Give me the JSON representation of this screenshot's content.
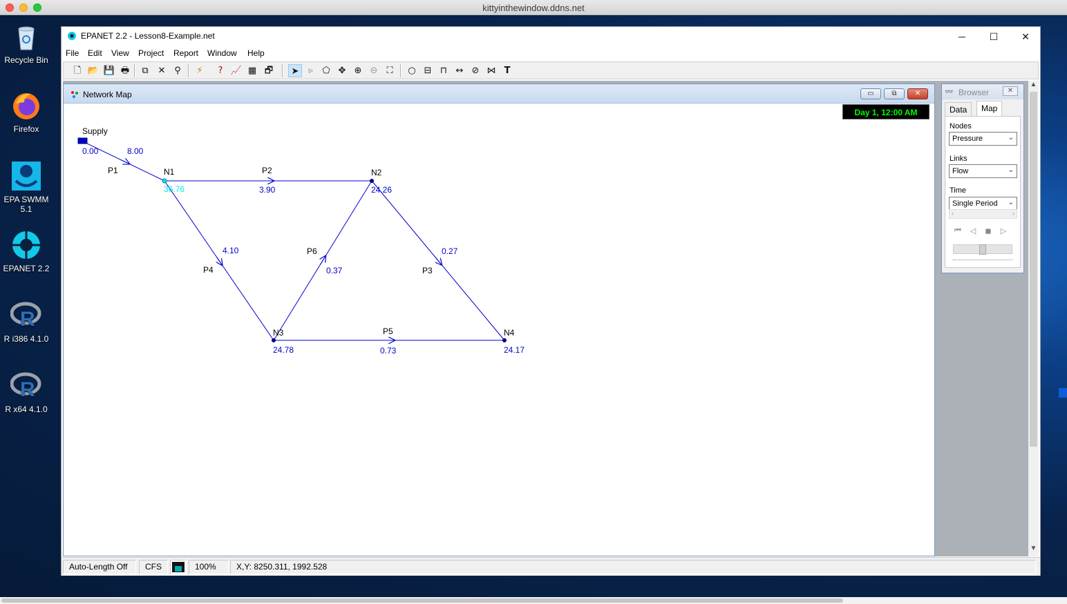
{
  "mac": {
    "window_title": "kittyinthewindow.ddns.net"
  },
  "desktop": {
    "icons": [
      {
        "label": "Recycle Bin",
        "icon": "recycle-bin-icon"
      },
      {
        "label": "Firefox",
        "icon": "firefox-icon"
      },
      {
        "label": "EPA SWMM 5.1",
        "icon": "epa-swmm-icon"
      },
      {
        "label": "EPANET 2.2",
        "icon": "epanet-icon"
      },
      {
        "label": "R i386 4.1.0",
        "icon": "r-icon"
      },
      {
        "label": "R x64 4.1.0",
        "icon": "r-icon"
      }
    ]
  },
  "app": {
    "title": "EPANET 2.2 - Lesson8-Example.net",
    "controls": {
      "minimize": "─",
      "maximize": "☐",
      "close": "✕"
    },
    "menu": [
      "File",
      "Edit",
      "View",
      "Project",
      "Report",
      "Window",
      "Help"
    ],
    "toolbar": [
      "new-file-icon",
      "open-folder-icon",
      "save-icon",
      "print-icon",
      "copy-icon",
      "delete-icon",
      "find-icon",
      "run-analysis-icon",
      "query-icon",
      "graph-icon",
      "table-icon",
      "options-icon",
      "select-object-icon",
      "select-vertex-icon",
      "select-region-icon",
      "pan-icon",
      "zoom-in-icon",
      "zoom-out-icon",
      "full-extent-icon",
      "add-junction-icon",
      "add-reservoir-icon",
      "add-tank-icon",
      "add-pipe-icon",
      "add-pump-icon",
      "add-valve-icon",
      "add-label-icon"
    ]
  },
  "network_map": {
    "title": "Network Map",
    "clock": "Day 1, 12:00 AM",
    "nodes": {
      "Supply": {
        "label": "Supply",
        "value": "0.00"
      },
      "N1": {
        "label": "N1",
        "value": "36.76"
      },
      "N2": {
        "label": "N2",
        "value": "24.26"
      },
      "N3": {
        "label": "N3",
        "value": "24.78"
      },
      "N4": {
        "label": "N4",
        "value": "24.17"
      }
    },
    "links": {
      "P1": {
        "label": "P1",
        "value": "8.00"
      },
      "P2": {
        "label": "P2",
        "value": "3.90"
      },
      "P3": {
        "label": "P3",
        "value": "0.27"
      },
      "P4": {
        "label": "P4",
        "value": "4.10"
      },
      "P5": {
        "label": "P5",
        "value": "0.73"
      },
      "P6": {
        "label": "P6",
        "value": "0.37"
      }
    },
    "colors": {
      "link": "#0000cc",
      "node": "#000080",
      "highlight": "#00e5ee",
      "label": "#000000"
    }
  },
  "browser": {
    "title": "Browser",
    "tabs": [
      "Data",
      "Map"
    ],
    "selected_tab": "Map",
    "nodes_label": "Nodes",
    "nodes_value": "Pressure",
    "links_label": "Links",
    "links_value": "Flow",
    "time_label": "Time",
    "time_value": "Single Period"
  },
  "statusbar": {
    "auto_length": "Auto-Length Off",
    "units": "CFS",
    "zoom": "100%",
    "xy": "X,Y: 8250.311, 1992.528"
  }
}
